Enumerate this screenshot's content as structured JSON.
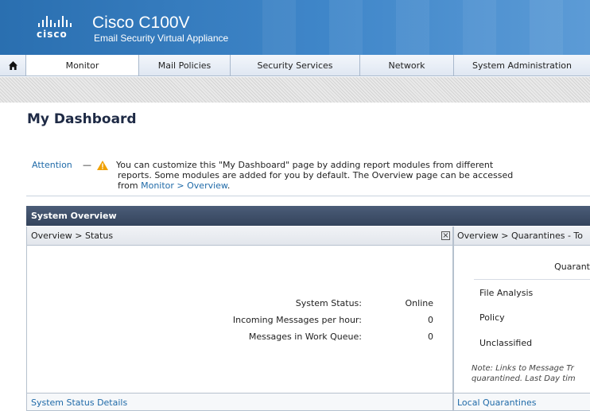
{
  "header": {
    "logo_text": "cisco",
    "product": "Cisco C100V",
    "subtitle": "Email Security Virtual Appliance"
  },
  "nav": {
    "home_icon": "home-icon",
    "items": [
      {
        "label": "Monitor",
        "active": true
      },
      {
        "label": "Mail Policies"
      },
      {
        "label": "Security Services"
      },
      {
        "label": "Network"
      },
      {
        "label": "System Administration"
      }
    ]
  },
  "page": {
    "title": "My Dashboard"
  },
  "attention": {
    "label": "Attention",
    "dash": "—",
    "icon": "warning-icon",
    "line1": "You can customize this \"My Dashboard\" page by adding report modules from different",
    "line2": "reports. Some modules are added for you by default. The Overview page can be accessed",
    "line3_prefix": "from ",
    "line3_link": "Monitor > Overview",
    "line3_suffix": "."
  },
  "system_overview": {
    "title": "System Overview",
    "status_panel": {
      "header": "Overview > Status",
      "close_icon": "close-box-icon",
      "rows": [
        {
          "label": "System Status:",
          "value": "Online"
        },
        {
          "label": "Incoming Messages per hour:",
          "value": "0"
        },
        {
          "label": "Messages in Work Queue:",
          "value": "0"
        }
      ],
      "footer_link": "System Status Details"
    },
    "quarantine_panel": {
      "header": "Overview > Quarantines - To",
      "column_title": "Quarant",
      "rows": [
        "File Analysis",
        "Policy",
        "Unclassified"
      ],
      "note_line1": "Note: Links to Message Tr",
      "note_line2": "quarantined. Last Day tim",
      "footer_link": "Local Quarantines"
    }
  },
  "colors": {
    "banner": "#2a6fb0",
    "panel_header": "#3e4f6a",
    "link": "#1f6aa8",
    "warning": "#f0a000"
  }
}
